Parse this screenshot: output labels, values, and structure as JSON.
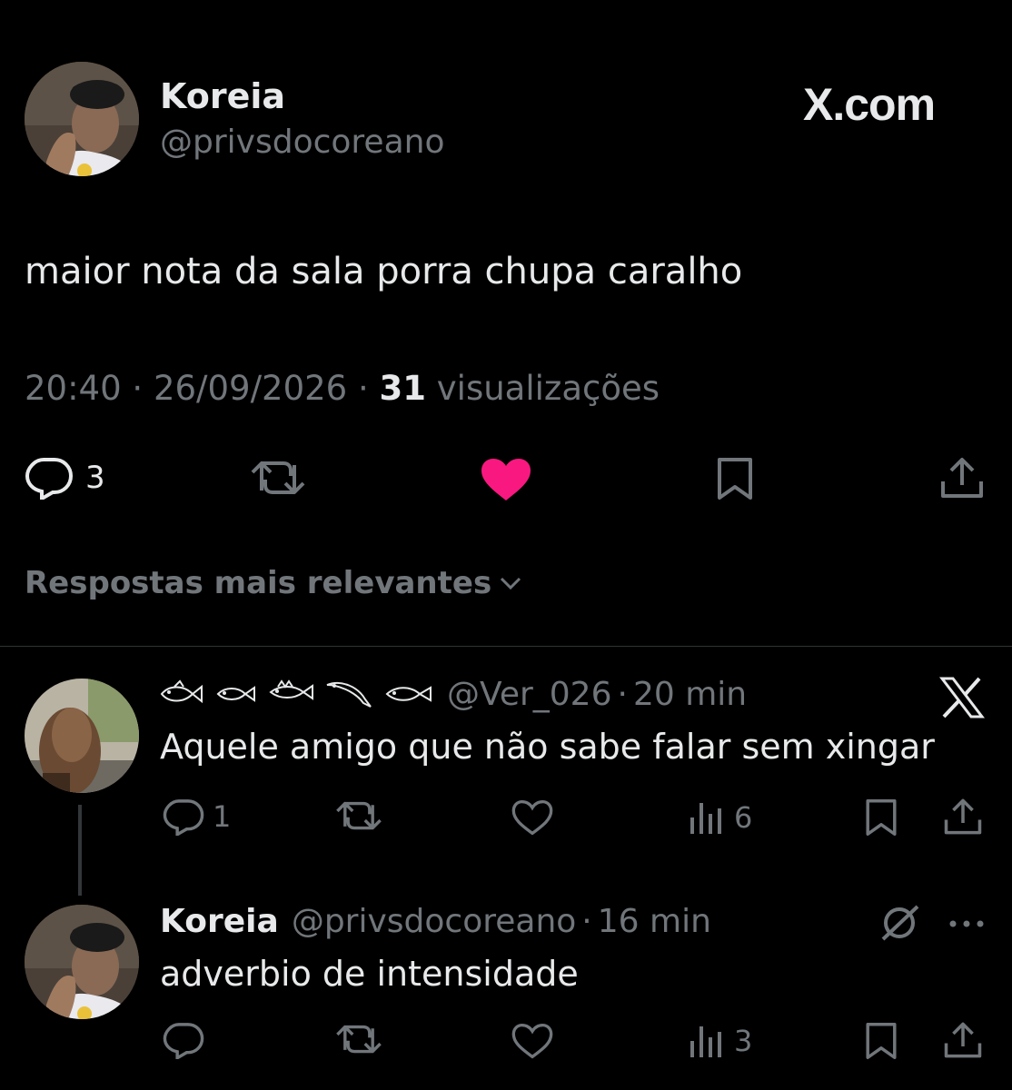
{
  "main_tweet": {
    "display_name": "Koreia",
    "handle": "@privsdocoreano",
    "brand": "X.com",
    "text": "maior nota da sala porra chupa caralho",
    "time": "20:40",
    "date": "26/09/2026",
    "views_count": "31",
    "views_label": "visualizações",
    "separator": "·",
    "actions": {
      "replies": "3"
    },
    "liked": true,
    "like_color": "#f91880"
  },
  "replies_sort": {
    "label": "Respostas mais relevantes"
  },
  "reply_1": {
    "handle": "@Ver_026",
    "separator": "·",
    "time": "20 min",
    "text": "Aquele amigo que não sabe falar sem xingar",
    "badge_icon": "x-logo-icon",
    "actions": {
      "replies": "1",
      "views": "6"
    }
  },
  "reply_2": {
    "display_name": "Koreia",
    "handle": "@privsdocoreano",
    "separator": "·",
    "time": "16 min",
    "text": "adverbio de intensidade",
    "badge_icon": "grok-icon",
    "actions": {
      "views": "3"
    }
  },
  "colors": {
    "background": "#000000",
    "text": "#e7e9ea",
    "muted": "#71767b",
    "divider": "#2f3336"
  }
}
